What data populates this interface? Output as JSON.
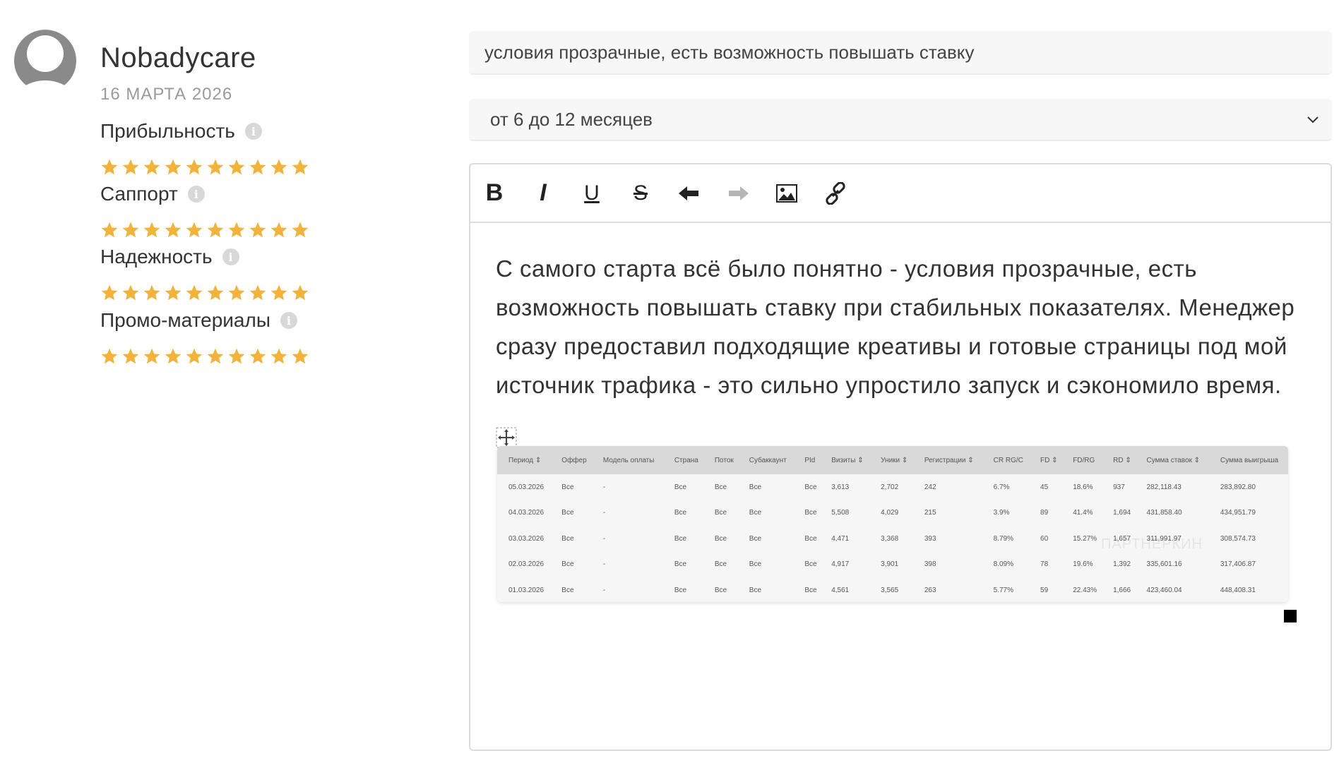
{
  "user": {
    "name": "Nobadycare",
    "date": "16 МАРТА 2026"
  },
  "ratings": [
    {
      "label": "Прибыльность",
      "stars": 10
    },
    {
      "label": "Саппорт",
      "stars": 10
    },
    {
      "label": "Надежность",
      "stars": 10
    },
    {
      "label": "Промо-материалы",
      "stars": 10
    }
  ],
  "colors": {
    "star": "#f2b33d",
    "accent_text": "#333333",
    "muted_text": "#9a9a9a"
  },
  "form": {
    "title_value": "условия прозрачные, есть возможность повышать ставку",
    "period_value": "от 6 до 12 месяцев"
  },
  "toolbar": {
    "bold": "B",
    "italic": "I",
    "underline": "U",
    "strike": "S",
    "undo_icon": "arrow-left-icon",
    "redo_icon": "arrow-right-icon",
    "image_icon": "image-icon",
    "link_icon": "link-icon"
  },
  "editor": {
    "text": "С самого старта всё было понятно - условия прозрачные, есть возможность повышать ставку при стабильных показателях. Менеджер сразу предоставил подходящие креативы и готовые страницы под мой источник трафика - это сильно упростило запуск и сэкономило время."
  },
  "embedded_table": {
    "headers": [
      "Период ⇕",
      "Оффер",
      "Модель оплаты",
      "Страна",
      "Поток",
      "Субаккаунт",
      "PId",
      "Визиты ⇕",
      "Уники ⇕",
      "Регистрации ⇕",
      "CR RG/C",
      "FD ⇕",
      "FD/RG",
      "RD ⇕",
      "Сумма ставок ⇕",
      "Сумма выигрыша"
    ],
    "rows": [
      [
        "05.03.2026",
        "Все",
        "-",
        "Все",
        "Все",
        "Все",
        "Все",
        "3,613",
        "2,702",
        "242",
        "6.7%",
        "45",
        "18.6%",
        "937",
        "282,118.43",
        "283,892.80"
      ],
      [
        "04.03.2026",
        "Все",
        "-",
        "Все",
        "Все",
        "Все",
        "Все",
        "5,508",
        "4,029",
        "215",
        "3.9%",
        "89",
        "41.4%",
        "1,694",
        "431,858.40",
        "434,951.79"
      ],
      [
        "03.03.2026",
        "Все",
        "-",
        "Все",
        "Все",
        "Все",
        "Все",
        "4,471",
        "3,368",
        "393",
        "8.79%",
        "60",
        "15.27%",
        "1,657",
        "311,991.97",
        "308,574.73"
      ],
      [
        "02.03.2026",
        "Все",
        "-",
        "Все",
        "Все",
        "Все",
        "Все",
        "4,917",
        "3,901",
        "398",
        "8.09%",
        "78",
        "19.6%",
        "1,392",
        "335,601.16",
        "317,406.87"
      ],
      [
        "01.03.2026",
        "Все",
        "-",
        "Все",
        "Все",
        "Все",
        "Все",
        "4,561",
        "3,565",
        "263",
        "5.77%",
        "59",
        "22.43%",
        "1,666",
        "423,460.04",
        "448,408.31"
      ]
    ],
    "watermark": "ПАРТНЕРКИН"
  }
}
